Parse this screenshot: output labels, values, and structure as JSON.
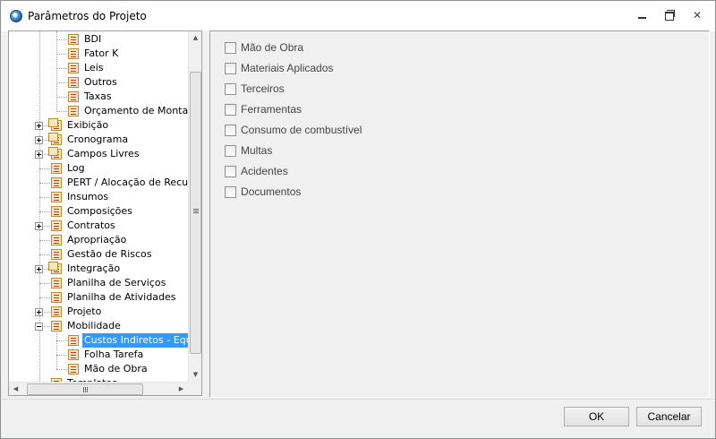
{
  "window": {
    "title": "Parâmetros do Projeto",
    "controls": {
      "minimize": "minimize-icon",
      "maximize": "maximize-icon",
      "close": "close-icon"
    }
  },
  "tree": {
    "items": [
      {
        "label": "BDI",
        "icon": "document-icon",
        "expander": ""
      },
      {
        "label": "Fator K",
        "icon": "document-icon",
        "expander": ""
      },
      {
        "label": "Leis",
        "icon": "document-icon",
        "expander": ""
      },
      {
        "label": "Outros",
        "icon": "document-icon",
        "expander": ""
      },
      {
        "label": "Taxas",
        "icon": "document-icon",
        "expander": ""
      },
      {
        "label": "Orçamento de Montagem",
        "icon": "document-icon",
        "expander": ""
      },
      {
        "label": "Exibição",
        "icon": "folder-icon",
        "expander": "plus"
      },
      {
        "label": "Cronograma",
        "icon": "folder-icon",
        "expander": "plus"
      },
      {
        "label": "Campos Livres",
        "icon": "folder-icon",
        "expander": "plus"
      },
      {
        "label": "Log",
        "icon": "document-icon",
        "expander": ""
      },
      {
        "label": "PERT / Alocação de Recursos",
        "icon": "document-icon",
        "expander": ""
      },
      {
        "label": "Insumos",
        "icon": "document-icon",
        "expander": ""
      },
      {
        "label": "Composições",
        "icon": "document-icon",
        "expander": ""
      },
      {
        "label": "Contratos",
        "icon": "document-icon",
        "expander": "plus"
      },
      {
        "label": "Apropriação",
        "icon": "document-icon",
        "expander": ""
      },
      {
        "label": "Gestão de Riscos",
        "icon": "document-icon",
        "expander": ""
      },
      {
        "label": "Integração",
        "icon": "folder-icon",
        "expander": "plus"
      },
      {
        "label": "Planilha de Serviços",
        "icon": "document-icon",
        "expander": ""
      },
      {
        "label": "Planilha de Atividades",
        "icon": "document-icon",
        "expander": ""
      },
      {
        "label": "Projeto",
        "icon": "document-icon",
        "expander": "plus"
      },
      {
        "label": "Mobilidade",
        "icon": "document-icon",
        "expander": "minus"
      },
      {
        "label": "Custos Indiretos - Equipamentos",
        "icon": "document-icon",
        "expander": "",
        "selected": true
      },
      {
        "label": "Folha Tarefa",
        "icon": "document-icon",
        "expander": ""
      },
      {
        "label": "Mão de Obra",
        "icon": "document-icon",
        "expander": ""
      },
      {
        "label": "Templates",
        "icon": "document-icon",
        "expander": ""
      }
    ],
    "selection_color": "#3399ff"
  },
  "options": [
    {
      "label": "Mão de Obra",
      "checked": false
    },
    {
      "label": "Materiais Aplicados",
      "checked": false
    },
    {
      "label": "Terceiros",
      "checked": false
    },
    {
      "label": "Ferramentas",
      "checked": false
    },
    {
      "label": "Consumo de combustível",
      "checked": false
    },
    {
      "label": "Multas",
      "checked": false
    },
    {
      "label": "Acidentes",
      "checked": false
    },
    {
      "label": "Documentos",
      "checked": false
    }
  ],
  "buttons": {
    "ok": "OK",
    "cancel": "Cancelar"
  }
}
